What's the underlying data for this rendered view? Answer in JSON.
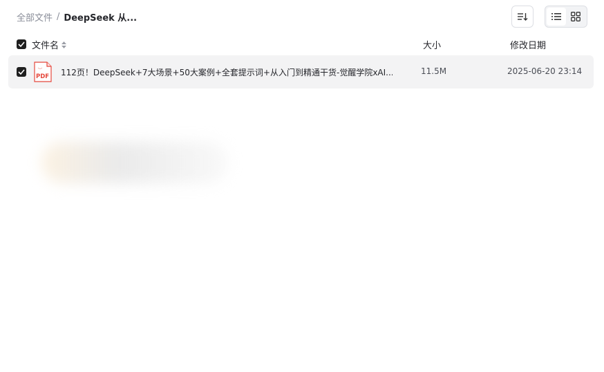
{
  "breadcrumb": {
    "root": "全部文件",
    "separator": "/",
    "current": "DeepSeek 从..."
  },
  "toolbar": {
    "sort_icon": "sort-icon",
    "list_view_icon": "list-view-icon",
    "grid_view_icon": "grid-view-icon",
    "active_view": "list"
  },
  "columns": {
    "name": "文件名",
    "size": "大小",
    "modified": "修改日期"
  },
  "files": [
    {
      "icon": "pdf-file-icon",
      "icon_text": "PDF",
      "name": "112页！DeepSeek+7大场景+50大案例+全套提示词+从入门到精通干货-觉醒学院xAI...",
      "size": "11.5M",
      "modified": "2025-06-20 23:14",
      "selected": true
    }
  ],
  "colors": {
    "checkbox": "#1f1f1f",
    "row_selected_bg": "#f3f3f4",
    "pdf_red": "#e5483c"
  }
}
